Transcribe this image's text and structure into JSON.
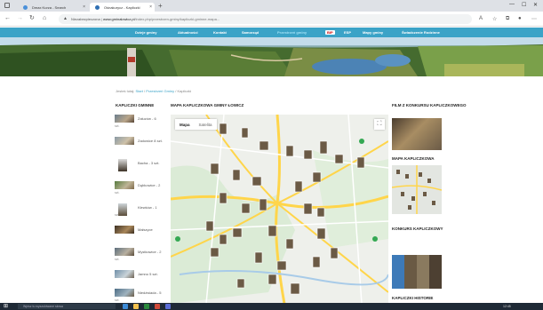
{
  "browser": {
    "tabs": [
      {
        "title": "Dmax Kurza - Search",
        "active": false
      },
      {
        "title": "Ośnakurycz - Kapliczki",
        "active": true
      }
    ],
    "url": {
      "warning": "Niezabezpieczona",
      "host": "www.gminalowicz.pl",
      "path": "/index.php/przestrzen-gminy/kapliczki-gminne-mapa..."
    }
  },
  "site_nav": {
    "items": [
      {
        "label": "Dzieje gminy",
        "active": false
      },
      {
        "label": "Aktualności",
        "active": false
      },
      {
        "label": "Kontakt",
        "active": false
      },
      {
        "label": "Samorząd",
        "active": false
      },
      {
        "label": "Przestrzeń gminy",
        "active": true
      },
      {
        "label": "BIP",
        "active": false,
        "badge": true
      },
      {
        "label": "ESP",
        "active": false
      },
      {
        "label": "Mapy gminy",
        "active": false
      },
      {
        "label": "Świadczenie Rodzinne",
        "active": false
      }
    ]
  },
  "breadcrumb": {
    "prefix": "Jesteś tutaj:",
    "items": [
      "Start",
      "Przestrzeń Gminy",
      "Kapliczki"
    ]
  },
  "left": {
    "heading": "KAPLICZKI GMINNE",
    "items": [
      {
        "name": "Zaluzów - 6",
        "count": "szt."
      },
      {
        "name": "Zadowice 8 szt.",
        "count": ""
      },
      {
        "name": "Bacha - 3 szt.",
        "count": ""
      },
      {
        "name": "Dąbkowice - 2",
        "count": "szt."
      },
      {
        "name": "Klewków - 1",
        "count": "szt."
      },
      {
        "name": "Małszyce",
        "count": ""
      },
      {
        "name": "Mystkowice - 2",
        "count": "szt."
      },
      {
        "name": "Jamno 5 szt.",
        "count": ""
      },
      {
        "name": "Niedźwiada - 5",
        "count": "szt."
      }
    ]
  },
  "map": {
    "heading": "MAPA KAPLICZKOWA GMINY ŁOWICZ",
    "tabs": [
      {
        "label": "Mapa",
        "active": true
      },
      {
        "label": "Satelita",
        "active": false
      }
    ],
    "fullscreen_icon": "fullscreen-icon"
  },
  "right": {
    "sections": [
      {
        "title": "FILM Z KONKURSU KAPLICZKOWEGO"
      },
      {
        "title": "MAPA KAPLICZKOWA"
      },
      {
        "title": "KONKURS KAPLICZKOWY"
      },
      {
        "title": "KAPLICZKI HISTORIE"
      }
    ]
  },
  "taskbar": {
    "search_placeholder": "Wpisz tu wyszukiwane słowa",
    "clock": "12:45"
  },
  "colors": {
    "nav_bg": "#3ba3c7",
    "nav_active": "#9fe0f5",
    "link": "#3ba3c7",
    "map_road": "#ffd54a",
    "taskbar": "#1f2a36"
  }
}
